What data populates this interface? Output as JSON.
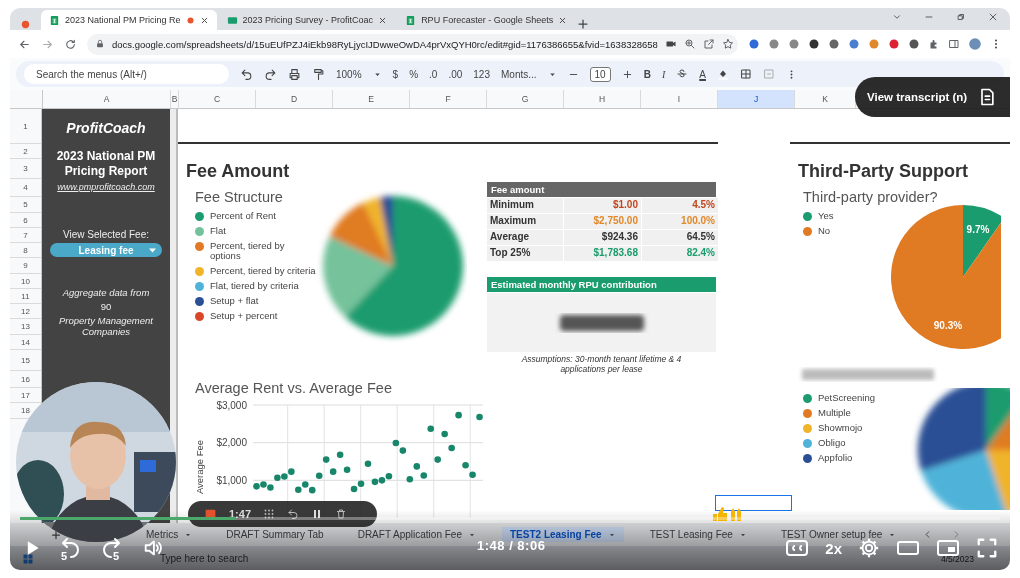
{
  "browser": {
    "tabs": [
      {
        "title": "2023 National PM Pricing Re",
        "selected": true
      },
      {
        "title": "2023 Pricing Survey - ProfitCoac",
        "selected": false
      },
      {
        "title": "RPU Forecaster - Google Sheets",
        "selected": false
      }
    ],
    "address": "docs.google.com/spreadsheets/d/15uEUfPZJ4iEkb98RyLjycIJDwweOwDA4prVxQYH0rc/edit#gid=1176386655&fvid=1638328658"
  },
  "toolbar": {
    "search_placeholder": "Search the menus (Alt+/)",
    "zoom": "100%",
    "number_formats": [
      "$",
      "%",
      ".0",
      ".00",
      "123"
    ],
    "font": "Monts...",
    "font_size": "10",
    "bold": "B",
    "italic": "I",
    "text_color": "A"
  },
  "sheet": {
    "columns": [
      {
        "label": "A",
        "selected": false
      },
      {
        "label": "B",
        "selected": false
      },
      {
        "label": "C",
        "selected": false
      },
      {
        "label": "D",
        "selected": false
      },
      {
        "label": "E",
        "selected": false
      },
      {
        "label": "F",
        "selected": false
      },
      {
        "label": "G",
        "selected": false
      },
      {
        "label": "H",
        "selected": false
      },
      {
        "label": "I",
        "selected": false
      },
      {
        "label": "J",
        "selected": true
      },
      {
        "label": "K",
        "selected": false
      }
    ],
    "rows": [
      "1",
      "2",
      "3",
      "4",
      "5",
      "6",
      "7",
      "8",
      "9",
      "10",
      "11",
      "12",
      "13",
      "14",
      "15",
      "16",
      "17",
      "18"
    ],
    "sidebar": {
      "brand": "ProfitCoach",
      "title": "2023 National PM Pricing Report",
      "link": "www.pmprofitcoach.com",
      "fee_label": "View Selected Fee:",
      "fee_select": "Leasing fee",
      "note_1": "Aggregate data from",
      "count": "90",
      "note_2": "Property Management Companies"
    },
    "fee_amount": {
      "heading": "Fee Amount",
      "chart_title": "Fee Structure",
      "legend": [
        {
          "label": "Percent of Rent",
          "color": "#1a9c6e"
        },
        {
          "label": "Flat",
          "color": "#74c29b"
        },
        {
          "label": "Percent, tiered by options",
          "color": "#e07b24"
        },
        {
          "label": "Percent, tiered by criteria",
          "color": "#f0b429"
        },
        {
          "label": "Flat, tiered by criteria",
          "color": "#4fb3d9"
        },
        {
          "label": "Setup + flat",
          "color": "#2b4f95"
        },
        {
          "label": "Setup + percent",
          "color": "#d9472b"
        }
      ]
    },
    "fee_table": {
      "header": "Fee amount",
      "rows": [
        {
          "label": "Minimum",
          "amount": "$1.00",
          "percent": "4.5%",
          "color": "#c0461f"
        },
        {
          "label": "Maximum",
          "amount": "$2,750.00",
          "percent": "100.0%",
          "color": "#e0882a"
        },
        {
          "label": "Average",
          "amount": "$924.36",
          "percent": "64.5%",
          "color": "#333333"
        },
        {
          "label": "Top 25%",
          "amount": "$1,783.68",
          "percent": "82.4%",
          "color": "#1a9c6e"
        }
      ]
    },
    "rpu": {
      "header": "Estimated monthly RPU contribution",
      "note": "Assumptions: 30-month tenant lifetime & 4 applications per lease"
    },
    "scatter": {
      "chart_data": {
        "type": "scatter",
        "title": "Average Rent vs. Average Fee",
        "ylabel": "Average Fee",
        "categories": [
          null,
          null,
          null,
          null,
          null,
          null,
          null,
          null,
          null,
          null,
          null,
          null,
          null,
          null,
          null,
          null,
          null,
          null,
          null,
          null,
          null,
          null,
          null,
          null,
          null,
          null,
          null,
          null,
          null,
          null,
          null,
          null,
          null
        ],
        "grid": true,
        "ylim": [
          0,
          3000
        ],
        "yticks": [
          {
            "value": 1000,
            "label": "$1,000"
          },
          {
            "value": 2000,
            "label": "$2,000"
          },
          {
            "value": 3000,
            "label": "$3,000"
          }
        ],
        "series": [
          {
            "color": "#17866a",
            "values": [
              840,
              890,
              810,
              1070,
              1100,
              1230,
              750,
              890,
              740,
              1120,
              1550,
              1230,
              1680,
              1280,
              770,
              910,
              1440,
              960,
              1000,
              1110,
              1990,
              1790,
              1030,
              1370,
              1130,
              2370,
              1550,
              2230,
              1860,
              2730,
              1400,
              1150,
              2680
            ]
          }
        ]
      }
    },
    "third_party": {
      "heading": "Third-Party Support",
      "chart_data": {
        "type": "pie",
        "title": "Third-party provider?",
        "categories": [
          "Yes",
          "No"
        ],
        "values": [
          9.7,
          90.3
        ],
        "colors": [
          "#1a9c6e",
          "#e07b24"
        ],
        "value_labels": [
          "9.7%",
          "90.3%"
        ]
      }
    },
    "providers": {
      "legend": [
        {
          "label": "PetScreening",
          "color": "#1a9c6e"
        },
        {
          "label": "Multiple",
          "color": "#e07b24"
        },
        {
          "label": "Showmojo",
          "color": "#f0b429"
        },
        {
          "label": "Obligo",
          "color": "#4fb3d9"
        },
        {
          "label": "Appfolio",
          "color": "#2b4f95"
        }
      ]
    },
    "sheet_tabs": [
      {
        "label": "Metrics",
        "selected": false
      },
      {
        "label": "DRAFT Summary Tab",
        "selected": false
      },
      {
        "label": "DRAFT Application Fee",
        "selected": false
      },
      {
        "label": "TEST2 Leasing Fee",
        "selected": true
      },
      {
        "label": "TEST Leasing Fee",
        "selected": false
      },
      {
        "label": "TEST Owner setup fee",
        "selected": false
      }
    ]
  },
  "taskbar": {
    "search_placeholder": "Type here to search",
    "date": "4/5/2023"
  },
  "player": {
    "transcript_button": "View transcript (n)",
    "recording_time": "1:47",
    "progress": {
      "level": 0.22
    },
    "skip_back": "5",
    "skip_forward": "5",
    "time": "1:48 / 8:06",
    "speed": "2x"
  }
}
